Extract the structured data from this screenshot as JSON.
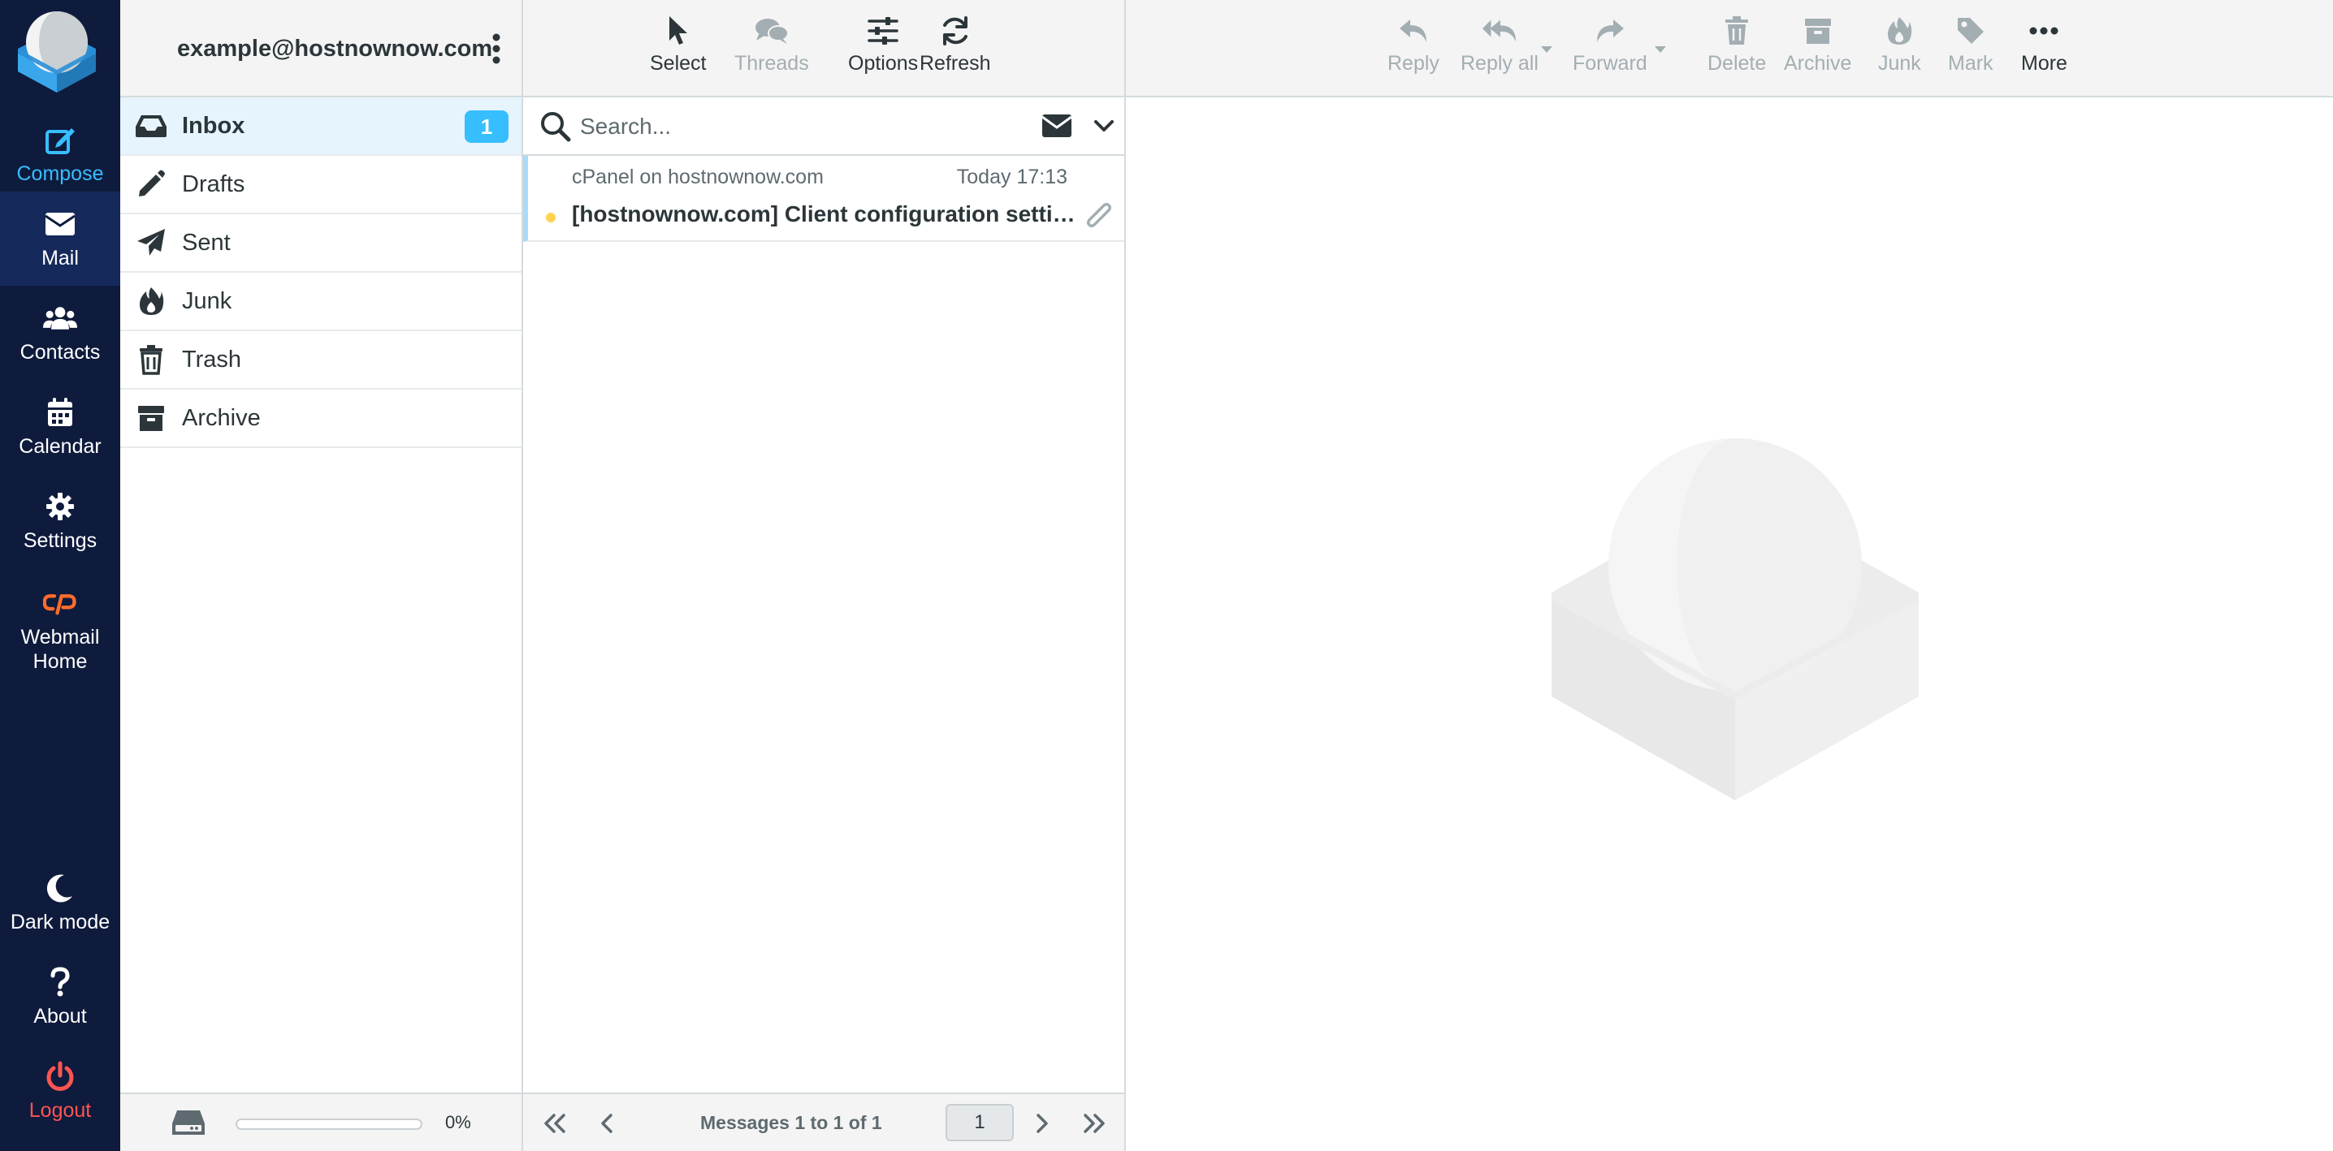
{
  "rail": {
    "items": [
      {
        "id": "compose",
        "label": "Compose",
        "icon": "compose-icon"
      },
      {
        "id": "mail",
        "label": "Mail",
        "icon": "envelope-icon"
      },
      {
        "id": "contacts",
        "label": "Contacts",
        "icon": "users-icon"
      },
      {
        "id": "calendar",
        "label": "Calendar",
        "icon": "calendar-icon"
      },
      {
        "id": "settings",
        "label": "Settings",
        "icon": "gear-icon"
      },
      {
        "id": "webmail-home",
        "label": "Webmail Home",
        "icon": "cpanel-icon"
      }
    ],
    "bottom": [
      {
        "id": "dark-mode",
        "label": "Dark mode",
        "icon": "moon-icon"
      },
      {
        "id": "about",
        "label": "About",
        "icon": "question-icon"
      },
      {
        "id": "logout",
        "label": "Logout",
        "icon": "power-icon"
      }
    ],
    "selected": "mail"
  },
  "account": {
    "email": "example@hostnownow.com"
  },
  "folders": [
    {
      "name": "Inbox",
      "icon": "inbox-icon",
      "unread": "1",
      "active": true
    },
    {
      "name": "Drafts",
      "icon": "pencil-icon"
    },
    {
      "name": "Sent",
      "icon": "paper-plane-icon"
    },
    {
      "name": "Junk",
      "icon": "fire-icon"
    },
    {
      "name": "Trash",
      "icon": "trash-icon"
    },
    {
      "name": "Archive",
      "icon": "archive-icon"
    }
  ],
  "quota": {
    "percent_label": "0%",
    "used_fraction": 0.0
  },
  "list_toolbar": {
    "select": "Select",
    "threads": "Threads",
    "options": "Options",
    "refresh": "Refresh"
  },
  "search": {
    "placeholder": "Search..."
  },
  "messages": [
    {
      "from": "cPanel on hostnownow.com",
      "date": "Today 17:13",
      "subject": "[hostnownow.com] Client configuration setting…",
      "unread": true,
      "has_attachment": true
    }
  ],
  "list_footer": {
    "count_label": "Messages 1 to 1 of 1",
    "page": "1"
  },
  "preview_toolbar": {
    "reply": "Reply",
    "reply_all": "Reply all",
    "forward": "Forward",
    "delete": "Delete",
    "archive": "Archive",
    "junk": "Junk",
    "mark": "Mark",
    "more": "More"
  },
  "colors": {
    "rail_bg": "#0e1b3d",
    "accent": "#37beff",
    "logout": "#ff5552",
    "unread_dot": "#ffd452"
  }
}
